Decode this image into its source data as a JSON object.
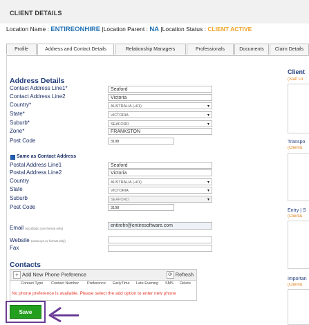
{
  "header": {
    "title": "CLIENT DETAILS"
  },
  "location": {
    "name_label": "Location Name :",
    "name_value": "ENTIREONHIRE",
    "parent_label": "|Location Parent :",
    "parent_value": "NA",
    "status_label": "|Location Status :",
    "status_value": "CLIENT ACTIVE"
  },
  "tabs": [
    {
      "label": "Profile"
    },
    {
      "label": "Address and Contact Details"
    },
    {
      "label": "Relationship Managers"
    },
    {
      "label": "Professionals"
    },
    {
      "label": "Documents"
    },
    {
      "label": "Claim Details"
    }
  ],
  "address": {
    "title": "Address Details",
    "contact_line1_label": "Contact Address Line1*",
    "contact_line1_value": "Seaford",
    "contact_line2_label": "Contact Address Line2",
    "contact_line2_value": "Victoria",
    "country_label": "Country*",
    "country_value": "AUSTRALIA (+61)",
    "state_label": "State*",
    "state_value": "VICTORIA",
    "suburb_label": "Suburb*",
    "suburb_value": "SEAFORD",
    "zone_label": "Zone*",
    "zone_value": "FRANKSTON",
    "postcode_label": "Post Code",
    "postcode_value": "3198"
  },
  "postal": {
    "same_as_label": "Same as Contact Address",
    "line1_label": "Postal Address Line1",
    "line1_value": "Seaford",
    "line2_label": "Postal Address Line2",
    "line2_value": "Victoria",
    "country_label": "Country",
    "country_value": "AUSTRALIA (+61)",
    "state_label": "State",
    "state_value": "VICTORIA",
    "suburb_label": "Suburb",
    "suburb_value": "SEAFORD",
    "postcode_label": "Post Code",
    "postcode_value": "3198"
  },
  "contact_fields": {
    "email_label": "Email",
    "email_hint": "(xyz@abc.com format only)",
    "email_value": "entirehr@entiresoftware.com",
    "website_label": "Website",
    "website_hint": "(www.xyz.xx format only)",
    "website_value": "",
    "fax_label": "Fax",
    "fax_value": ""
  },
  "contacts": {
    "title": "Contacts",
    "add_label": "Add New Phone Preference",
    "refresh_label": "Refresh",
    "columns": [
      "Contact Type",
      "Contact Number",
      "Preference",
      "EarlyTime",
      "Late Evening",
      "SMS",
      "Delete"
    ],
    "empty_message": "No phone preference is available. Please select the add option to enter new phone"
  },
  "save_label": "Save",
  "right_panel": {
    "h1": "Client",
    "h1_sub": "(Staff Or",
    "h2": "Transpo",
    "h2_sub": "(Client&",
    "h3": "Entry | S",
    "h3_sub": "(Client&",
    "h4": "Importan",
    "h4_sub": "(Client&"
  },
  "colors": {
    "accent": "#1f6fb3",
    "status": "#f0a020",
    "save": "#239f1f",
    "highlight": "#6a3c96",
    "error": "#e53b2e"
  }
}
